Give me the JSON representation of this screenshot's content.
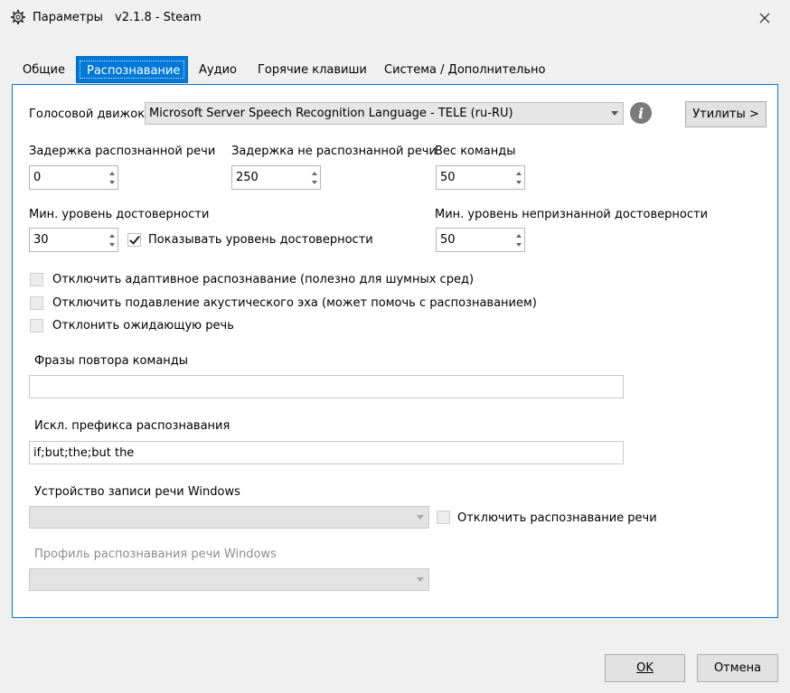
{
  "window": {
    "title": "Параметры",
    "version": "v2.1.8 - Steam",
    "close_glyph": "✕"
  },
  "tabs": [
    {
      "label": "Общие",
      "active": false
    },
    {
      "label": "Распознавание",
      "active": true
    },
    {
      "label": "Аудио",
      "active": false
    },
    {
      "label": "Горячие клавиши",
      "active": false
    },
    {
      "label": "Система / Дополнительно",
      "active": false
    }
  ],
  "engine": {
    "label": "Голосовой движок",
    "value": "Microsoft Server Speech Recognition Language - TELE (ru-RU)",
    "utilities_label": "Утилиты >"
  },
  "delays": {
    "recognized_label": "Задержка распознанной речи",
    "recognized_value": "0",
    "unrecognized_label": "Задержка не распознанной речи",
    "unrecognized_value": "250",
    "weight_label": "Вес команды",
    "weight_value": "50"
  },
  "confidence": {
    "min_label": "Мин. уровень достоверности",
    "min_value": "30",
    "show_label": "Показывать уровень достоверности",
    "show_checked": true,
    "unrecognized_min_label": "Мин. уровень непризнанной достоверности",
    "unrecognized_min_value": "50"
  },
  "options": [
    {
      "label": "Отключить адаптивное распознавание (полезно для шумных сред)",
      "checked": false
    },
    {
      "label": "Отключить подавление акустического эха (может помочь с распознаванием)",
      "checked": false
    },
    {
      "label": "Отклонить ожидающую речь",
      "checked": false
    }
  ],
  "repeat_phrases": {
    "label": "Фразы повтора команды",
    "value": ""
  },
  "prefix_exclusions": {
    "label": "Искл. префикса распознавания",
    "value": "if;but;the;but the"
  },
  "recording_device": {
    "label": "Устройство записи речи Windows",
    "value": "",
    "disable_label": "Отключить распознавание речи",
    "disable_checked": false
  },
  "speech_profile": {
    "label": "Профиль распознавания речи Windows",
    "value": ""
  },
  "footer": {
    "ok_label": "OK",
    "cancel_label": "Отмена"
  },
  "colors": {
    "accent": "#0078d7",
    "background": "#f0f0f0",
    "disabled_text": "#8d8d8d"
  }
}
